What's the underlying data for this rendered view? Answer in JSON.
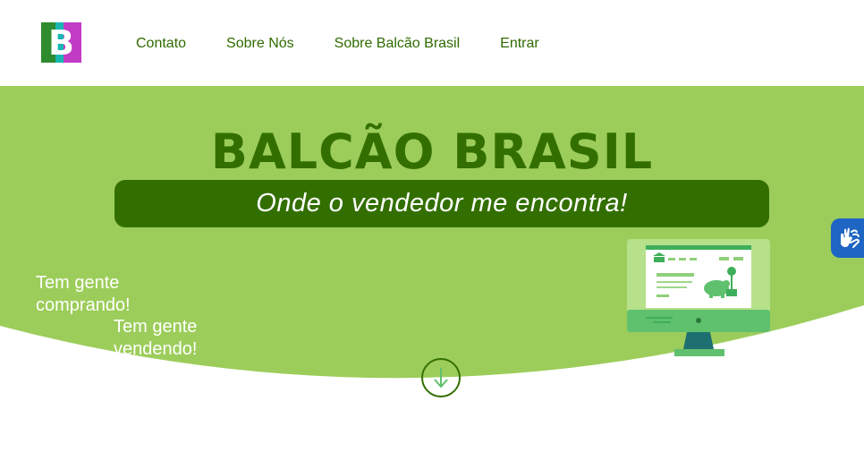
{
  "header": {
    "logo_letter": "B",
    "nav": [
      {
        "label": "Contato"
      },
      {
        "label": "Sobre Nós"
      },
      {
        "label": "Sobre Balcão Brasil"
      },
      {
        "label": "Entrar"
      }
    ]
  },
  "hero": {
    "title": "BALCÃO BRASIL",
    "tagline": "Onde o vendedor me encontra!",
    "buyers_text": "Tem gente comprando!",
    "sellers_text": "Tem gente vendendo!",
    "scroll_icon": "arrow-down-icon",
    "illustration_icon": "computer-monitor-icon"
  },
  "accessibility": {
    "icon": "sign-language-hands-icon"
  },
  "colors": {
    "hero_bg": "#9ccd5a",
    "brand_dark": "#336f00",
    "nav_text": "#2f6b00",
    "a11y_bg": "#1f65c4"
  }
}
